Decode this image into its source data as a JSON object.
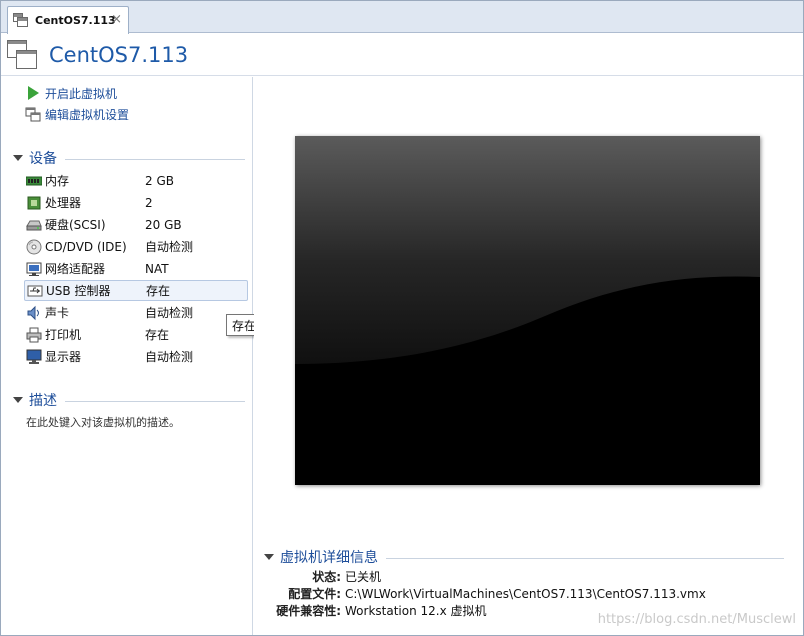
{
  "tab": {
    "title": "CentOS7.113",
    "close": "×"
  },
  "header": {
    "title": "CentOS7.113"
  },
  "actions": [
    {
      "label": "开启此虚拟机"
    },
    {
      "label": "编辑虚拟机设置"
    }
  ],
  "devices_section": {
    "title": "设备",
    "items": [
      {
        "name": "内存",
        "value": "2 GB",
        "icon": "memory-icon"
      },
      {
        "name": "处理器",
        "value": "2",
        "icon": "processor-icon"
      },
      {
        "name": "硬盘(SCSI)",
        "value": "20 GB",
        "icon": "hard-disk-icon"
      },
      {
        "name": "CD/DVD (IDE)",
        "value": "自动检测",
        "icon": "cd-dvd-icon"
      },
      {
        "name": "网络适配器",
        "value": "NAT",
        "icon": "network-adapter-icon"
      },
      {
        "name": "USB 控制器",
        "value": "存在",
        "icon": "usb-icon"
      },
      {
        "name": "声卡",
        "value": "自动检测",
        "icon": "sound-card-icon"
      },
      {
        "name": "打印机",
        "value": "存在",
        "icon": "printer-icon"
      },
      {
        "name": "显示器",
        "value": "自动检测",
        "icon": "display-icon"
      }
    ]
  },
  "tooltip": {
    "text": "存在"
  },
  "description_section": {
    "title": "描述",
    "placeholder": "在此处键入对该虚拟机的描述。"
  },
  "details_section": {
    "title": "虚拟机详细信息",
    "rows": [
      {
        "key": "状态:",
        "value": "已关机"
      },
      {
        "key": "配置文件:",
        "value": "C:\\WLWork\\VirtualMachines\\CentOS7.113\\CentOS7.113.vmx"
      },
      {
        "key": "硬件兼容性:",
        "value": "Workstation 12.x 虚拟机"
      }
    ]
  },
  "watermark": "https://blog.csdn.net/Musclewl",
  "colors": {
    "link": "#1e4e9a",
    "title": "#1e5aa8",
    "play": "#3aa33a"
  }
}
